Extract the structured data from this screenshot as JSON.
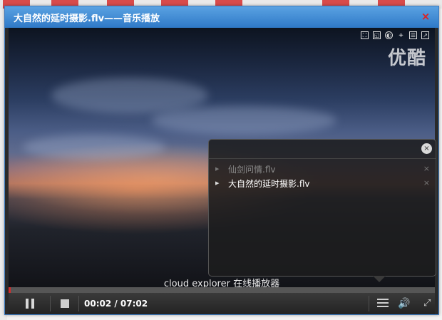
{
  "window": {
    "title": "大自然的延时摄影.flv——音乐播放",
    "close_glyph": "×"
  },
  "video": {
    "watermark": "优酷",
    "toolbar_icons": [
      "fit-screen-icon",
      "ratio-icon",
      "brightness-icon",
      "settings-icon",
      "subtitle-icon",
      "popout-icon"
    ]
  },
  "playlist": {
    "close_glyph": "×",
    "items": [
      {
        "name": "仙剑问情.flv",
        "state": "inactive",
        "remove_glyph": "×"
      },
      {
        "name": "大自然的延时摄影.flv",
        "state": "active",
        "remove_glyph": "×"
      }
    ]
  },
  "caption": "cloud explorer 在线播放器",
  "controls": {
    "time": "00:02 / 07:02",
    "progress_fraction": 0.005,
    "volume_glyph": "🔊",
    "fullscreen_glyph": "⤢"
  },
  "colors": {
    "title_bar": "#2f79c7",
    "close_red": "#d22222",
    "progress_red": "#d22c2c"
  }
}
